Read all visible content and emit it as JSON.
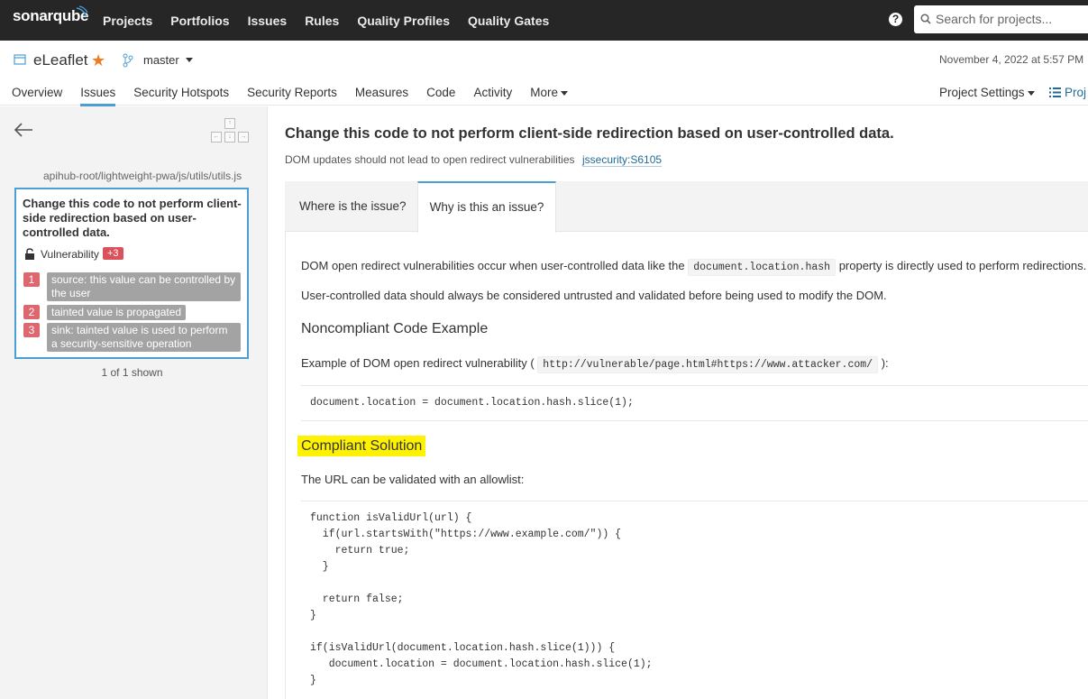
{
  "topnav": {
    "logo": "sonarqube",
    "links": [
      "Projects",
      "Portfolios",
      "Issues",
      "Rules",
      "Quality Profiles",
      "Quality Gates"
    ],
    "help_icon": "question-circle-icon",
    "search_placeholder": "Search for projects..."
  },
  "project": {
    "name": "eLeaflet",
    "branch": "master",
    "date": "November 4, 2022 at 5:57 PM",
    "tabs": [
      "Overview",
      "Issues",
      "Security Hotspots",
      "Security Reports",
      "Measures",
      "Code",
      "Activity",
      "More"
    ],
    "active_tab": "Issues",
    "settings": "Project Settings",
    "info": "Proj"
  },
  "sidebar": {
    "file_path": "apihub-root/lightweight-pwa/js/utils/utils.js",
    "issue": {
      "title": "Change this code to not perform client-side redirection based on user-controlled data.",
      "type": "Vulnerability",
      "extra_count": "+3",
      "locations": [
        {
          "num": "1",
          "text": "source: this value can be controlled by the user"
        },
        {
          "num": "2",
          "text": "tainted value is propagated"
        },
        {
          "num": "3",
          "text": "sink: tainted value is used to perform a security-sensitive operation"
        }
      ]
    },
    "shown": "1 of 1 shown"
  },
  "rule": {
    "title": "Change this code to not perform client-side redirection based on user-controlled data.",
    "subtitle": "DOM updates should not lead to open redirect vulnerabilities",
    "key": "jssecurity:S6105",
    "tabs": {
      "where": "Where is the issue?",
      "why": "Why is this an issue?"
    },
    "p1_before": "DOM open redirect vulnerabilities occur when user-controlled data like the",
    "p1_code": "document.location.hash",
    "p1_after": "property is directly used to perform redirections.",
    "p2": "User-controlled data should always be considered untrusted and validated before being used to modify the DOM.",
    "h_noncompliant": "Noncompliant Code Example",
    "p3_before": "Example of DOM open redirect vulnerability (",
    "p3_code": "http://vulnerable/page.html#https://www.attacker.com/",
    "p3_after": "):",
    "code1": "document.location = document.location.hash.slice(1);",
    "h_compliant": "Compliant Solution",
    "p4": "The URL can be validated with an allowlist:",
    "code2": [
      "function isValidUrl(url) {",
      "  if(url.startsWith(\"https://www.example.com/\")) {",
      "    return true;",
      "  }",
      "",
      "  return false;",
      "}",
      "",
      "if(isValidUrl(document.location.hash.slice(1))) {",
      "   document.location = document.location.hash.slice(1);",
      "}"
    ]
  },
  "colors": {
    "topbar": "#262626",
    "accent": "#4b9fd5",
    "star": "#ed7d20",
    "location": "#d4333f",
    "highlight": "#fff200"
  }
}
